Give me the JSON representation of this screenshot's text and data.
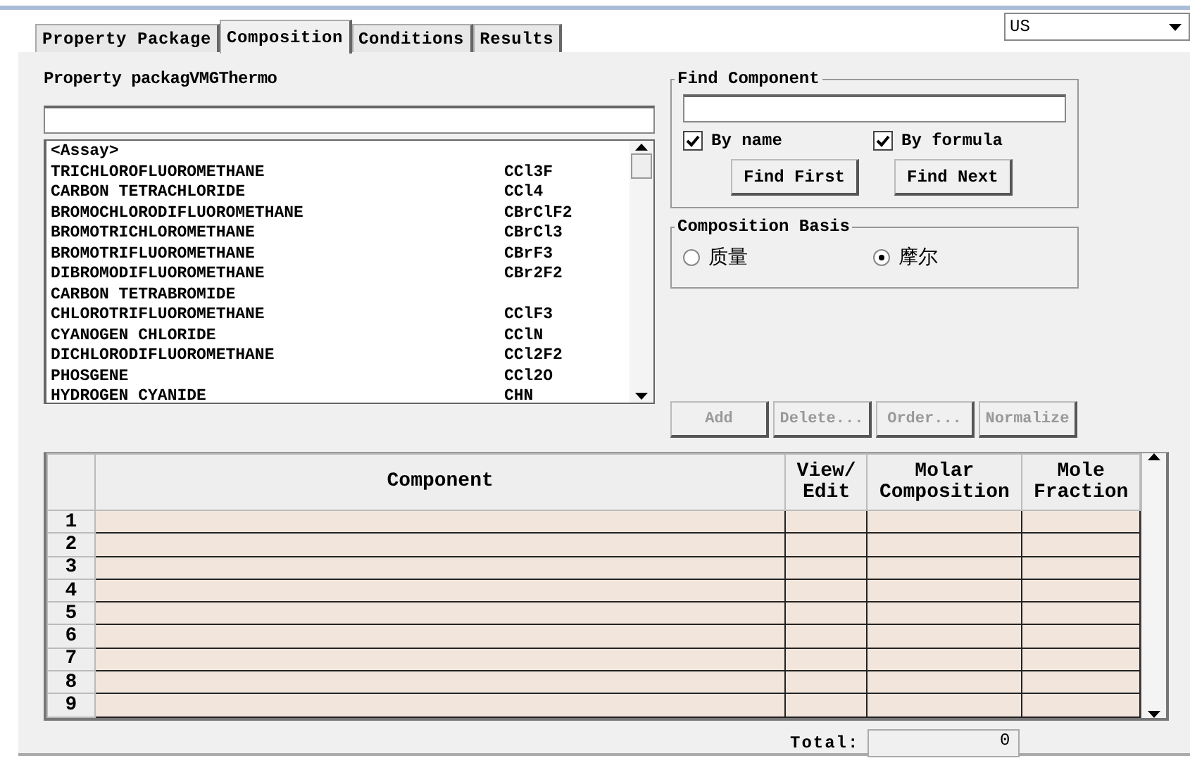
{
  "tabs": [
    {
      "label": "Property Package",
      "selected": false
    },
    {
      "label": "Composition",
      "selected": true
    },
    {
      "label": "Conditions",
      "selected": false
    },
    {
      "label": "Results",
      "selected": false
    }
  ],
  "units_dropdown": {
    "value": "US"
  },
  "property_package": {
    "label": "Property packag",
    "value": "VMGThermo"
  },
  "component_list": [
    {
      "name": "<Assay>"
    },
    {
      "name": "TRICHLOROFLUOROMETHANE",
      "formula": "CCl3F"
    },
    {
      "name": "CARBON TETRACHLORIDE",
      "formula": "CCl4"
    },
    {
      "name": "BROMOCHLORODIFLUOROMETHANE",
      "formula": "CBrClF2"
    },
    {
      "name": "BROMOTRICHLOROMETHANE",
      "formula": "CBrCl3"
    },
    {
      "name": "BROMOTRIFLUOROMETHANE",
      "formula": "CBrF3"
    },
    {
      "name": "DIBROMODIFLUOROMETHANE",
      "formula": "CBr2F2"
    },
    {
      "name": "CARBON TETRABROMIDE"
    },
    {
      "name": "CHLOROTRIFLUOROMETHANE",
      "formula": "CClF3"
    },
    {
      "name": "CYANOGEN CHLORIDE",
      "formula": "CClN"
    },
    {
      "name": "DICHLORODIFLUOROMETHANE",
      "formula": "CCl2F2"
    },
    {
      "name": "PHOSGENE",
      "formula": "CCl2O"
    },
    {
      "name": "HYDROGEN CYANIDE",
      "formula": "CHN"
    }
  ],
  "find_component": {
    "title": "Find Component",
    "checkboxes": [
      {
        "label": "By name",
        "checked": true
      },
      {
        "label": "By formula",
        "checked": true
      }
    ],
    "buttons": [
      {
        "label": "Find First"
      },
      {
        "label": "Find Next"
      }
    ]
  },
  "composition_basis": {
    "title": "Composition Basis",
    "options": [
      {
        "label": "质量",
        "selected": false
      },
      {
        "label": "摩尔",
        "selected": true
      }
    ]
  },
  "action_buttons": [
    {
      "label": "Add",
      "disabled": true
    },
    {
      "label": "Delete...",
      "disabled": true
    },
    {
      "label": "Order...",
      "disabled": true
    },
    {
      "label": "Normalize",
      "disabled": true
    }
  ],
  "grid": {
    "columns": [
      "Component",
      "View/\nEdit",
      "Molar\nComposition",
      "Mole\nFraction"
    ],
    "rows": [
      "1",
      "2",
      "3",
      "4",
      "5",
      "6",
      "7",
      "8",
      "9"
    ]
  },
  "total": {
    "label": "Total:",
    "value": "0"
  }
}
